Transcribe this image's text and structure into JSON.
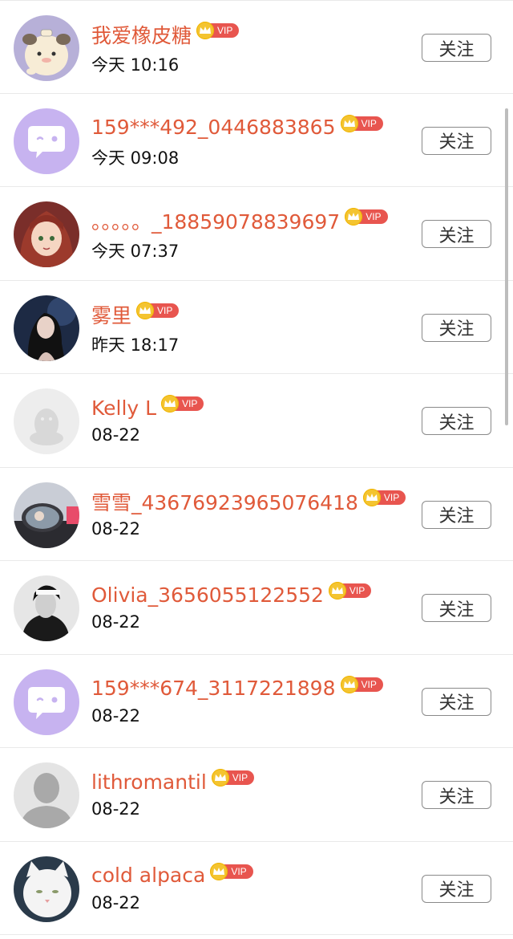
{
  "follow_label": "关注",
  "vip_label": "VIP",
  "users": [
    {
      "name": "我爱橡皮糖",
      "time": "今天 10:16",
      "avatar": "cartoon-bear-avatar"
    },
    {
      "name": "159***492_0446883865",
      "time": "今天 09:08",
      "avatar": "purple-default-avatar"
    },
    {
      "name": "。。。。。_18859078839697",
      "time": "今天 07:37",
      "avatar": "anime-girl-avatar"
    },
    {
      "name": "雾里",
      "time": "昨天 18:17",
      "avatar": "photo-girl-avatar"
    },
    {
      "name": "Kelly L",
      "time": "08-22",
      "avatar": "penguin-default-avatar"
    },
    {
      "name": "雪雪_43676923965076418",
      "time": "08-22",
      "avatar": "car-mirror-avatar"
    },
    {
      "name": "Olivia_3656055122552",
      "time": "08-22",
      "avatar": "bw-portrait-avatar"
    },
    {
      "name": "159***674_3117221898",
      "time": "08-22",
      "avatar": "purple-default-avatar"
    },
    {
      "name": "lithromantil",
      "time": "08-22",
      "avatar": "gray-silhouette-avatar"
    },
    {
      "name": "cold alpaca",
      "time": "08-22",
      "avatar": "white-cat-avatar"
    }
  ],
  "colors": {
    "name": "#e05a3a",
    "vip_tag": "#e8554f",
    "crown": "#f4c430",
    "purple_avatar": "#c7b3f0"
  }
}
